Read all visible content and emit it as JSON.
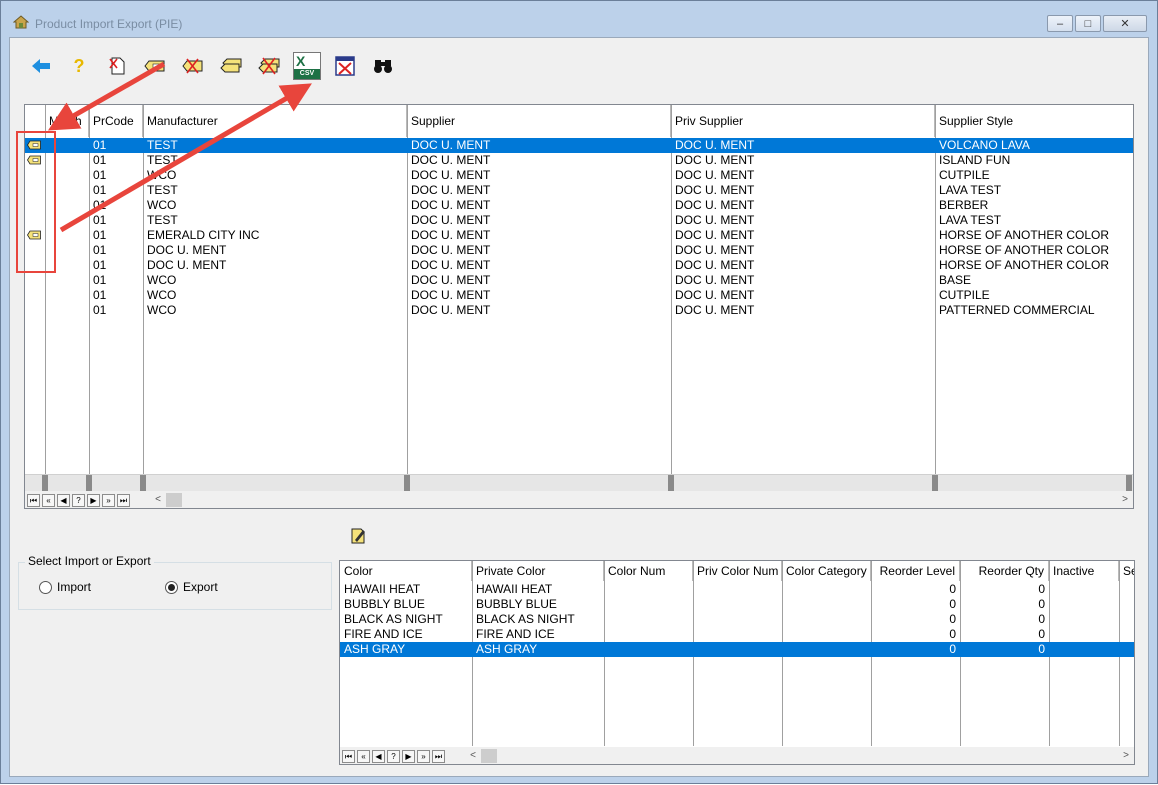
{
  "window": {
    "title": "Product Import Export (PIE)",
    "minimize": "–",
    "maximize": "□",
    "close": "✕"
  },
  "toolbar": [
    {
      "id": "back",
      "icon": "back-arrow-icon"
    },
    {
      "id": "help",
      "icon": "help-icon",
      "glyph": "?"
    },
    {
      "id": "new",
      "icon": "new-document-icon"
    },
    {
      "id": "tag",
      "icon": "tag-icon"
    },
    {
      "id": "tag-delete",
      "icon": "tag-delete-icon"
    },
    {
      "id": "tag-multiple",
      "icon": "tag-multiple-icon"
    },
    {
      "id": "tag-multiple-delete",
      "icon": "tag-multiple-delete-icon"
    },
    {
      "id": "export-csv",
      "icon": "excel-csv-icon",
      "letter": "X",
      "label": "CSV"
    },
    {
      "id": "cancel",
      "icon": "cancel-window-icon"
    },
    {
      "id": "find",
      "icon": "binoculars-icon"
    }
  ],
  "product_grid": {
    "columns": [
      {
        "key": "tag",
        "label": ""
      },
      {
        "key": "match",
        "label": "Match"
      },
      {
        "key": "prcode",
        "label": "PrCode"
      },
      {
        "key": "manufacturer",
        "label": "Manufacturer"
      },
      {
        "key": "supplier",
        "label": "Supplier"
      },
      {
        "key": "priv_supplier",
        "label": "Priv Supplier"
      },
      {
        "key": "supplier_style",
        "label": "Supplier Style"
      }
    ],
    "rows": [
      {
        "tagged": true,
        "match": "",
        "prcode": "01",
        "manufacturer": "TEST",
        "supplier": "DOC U. MENT",
        "priv_supplier": "DOC U. MENT",
        "supplier_style": "VOLCANO LAVA",
        "selected": true
      },
      {
        "tagged": true,
        "match": "",
        "prcode": "01",
        "manufacturer": "TEST",
        "supplier": "DOC U. MENT",
        "priv_supplier": "DOC U. MENT",
        "supplier_style": "ISLAND FUN",
        "selected": false
      },
      {
        "tagged": false,
        "match": "",
        "prcode": "01",
        "manufacturer": "WCO",
        "supplier": "DOC U. MENT",
        "priv_supplier": "DOC U. MENT",
        "supplier_style": "CUTPILE",
        "selected": false
      },
      {
        "tagged": false,
        "match": "",
        "prcode": "01",
        "manufacturer": "TEST",
        "supplier": "DOC U. MENT",
        "priv_supplier": "DOC U. MENT",
        "supplier_style": "LAVA TEST",
        "selected": false
      },
      {
        "tagged": false,
        "match": "",
        "prcode": "01",
        "manufacturer": "WCO",
        "supplier": "DOC U. MENT",
        "priv_supplier": "DOC U. MENT",
        "supplier_style": "BERBER",
        "selected": false
      },
      {
        "tagged": false,
        "match": "",
        "prcode": "01",
        "manufacturer": "TEST",
        "supplier": "DOC U. MENT",
        "priv_supplier": "DOC U. MENT",
        "supplier_style": "LAVA TEST",
        "selected": false
      },
      {
        "tagged": true,
        "match": "",
        "prcode": "01",
        "manufacturer": "EMERALD CITY INC",
        "supplier": "DOC U. MENT",
        "priv_supplier": "DOC U. MENT",
        "supplier_style": "HORSE OF ANOTHER COLOR",
        "selected": false
      },
      {
        "tagged": false,
        "match": "",
        "prcode": "01",
        "manufacturer": "DOC U. MENT",
        "supplier": "DOC U. MENT",
        "priv_supplier": "DOC U. MENT",
        "supplier_style": "HORSE OF ANOTHER COLOR",
        "selected": false
      },
      {
        "tagged": false,
        "match": "",
        "prcode": "01",
        "manufacturer": "DOC U. MENT",
        "supplier": "DOC U. MENT",
        "priv_supplier": "DOC U. MENT",
        "supplier_style": "HORSE OF ANOTHER COLOR",
        "selected": false
      },
      {
        "tagged": false,
        "match": "",
        "prcode": "01",
        "manufacturer": "WCO",
        "supplier": "DOC U. MENT",
        "priv_supplier": "DOC U. MENT",
        "supplier_style": "BASE",
        "selected": false
      },
      {
        "tagged": false,
        "match": "",
        "prcode": "01",
        "manufacturer": "WCO",
        "supplier": "DOC U. MENT",
        "priv_supplier": "DOC U. MENT",
        "supplier_style": "CUTPILE",
        "selected": false
      },
      {
        "tagged": false,
        "match": "",
        "prcode": "01",
        "manufacturer": "WCO",
        "supplier": "DOC U. MENT",
        "priv_supplier": "DOC U. MENT",
        "supplier_style": "PATTERNED COMMERCIAL",
        "selected": false
      }
    ]
  },
  "record_nav": [
    "⏮",
    "«",
    "◀",
    "?",
    "▶",
    "»",
    "⏭"
  ],
  "scroll": {
    "left": "<",
    "right": ">"
  },
  "import_export": {
    "label": "Select Import or Export",
    "options": [
      {
        "label": "Import",
        "checked": false
      },
      {
        "label": "Export",
        "checked": true
      }
    ]
  },
  "color_grid": {
    "edit_icon": "edit-note-icon",
    "columns": [
      {
        "key": "color",
        "label": "Color"
      },
      {
        "key": "private_color",
        "label": "Private Color"
      },
      {
        "key": "color_num",
        "label": "Color Num"
      },
      {
        "key": "priv_color_num",
        "label": "Priv Color Num"
      },
      {
        "key": "color_category",
        "label": "Color Category"
      },
      {
        "key": "reorder_level",
        "label": "Reorder Level"
      },
      {
        "key": "reorder_qty",
        "label": "Reorder Qty"
      },
      {
        "key": "inactive",
        "label": "Inactive"
      },
      {
        "key": "se",
        "label": "Se"
      }
    ],
    "rows": [
      {
        "color": "HAWAII HEAT",
        "private_color": "HAWAII HEAT",
        "color_num": "",
        "priv_color_num": "",
        "color_category": "",
        "reorder_level": "0",
        "reorder_qty": "0",
        "inactive": "",
        "se": "",
        "selected": false
      },
      {
        "color": "BUBBLY BLUE",
        "private_color": "BUBBLY BLUE",
        "color_num": "",
        "priv_color_num": "",
        "color_category": "",
        "reorder_level": "0",
        "reorder_qty": "0",
        "inactive": "",
        "se": "",
        "selected": false
      },
      {
        "color": "BLACK AS NIGHT",
        "private_color": "BLACK AS NIGHT",
        "color_num": "",
        "priv_color_num": "",
        "color_category": "",
        "reorder_level": "0",
        "reorder_qty": "0",
        "inactive": "",
        "se": "",
        "selected": false
      },
      {
        "color": "FIRE AND ICE",
        "private_color": "FIRE AND ICE",
        "color_num": "",
        "priv_color_num": "",
        "color_category": "",
        "reorder_level": "0",
        "reorder_qty": "0",
        "inactive": "",
        "se": "",
        "selected": false
      },
      {
        "color": "ASH GRAY",
        "private_color": "ASH GRAY",
        "color_num": "",
        "priv_color_num": "",
        "color_category": "",
        "reorder_level": "0",
        "reorder_qty": "0",
        "inactive": "",
        "se": "",
        "selected": true
      }
    ]
  },
  "colors": {
    "selection": "#0078d7",
    "annotation": "#e8453c",
    "excel_green": "#1e7145",
    "tag_yellow": "#f5e27a"
  }
}
